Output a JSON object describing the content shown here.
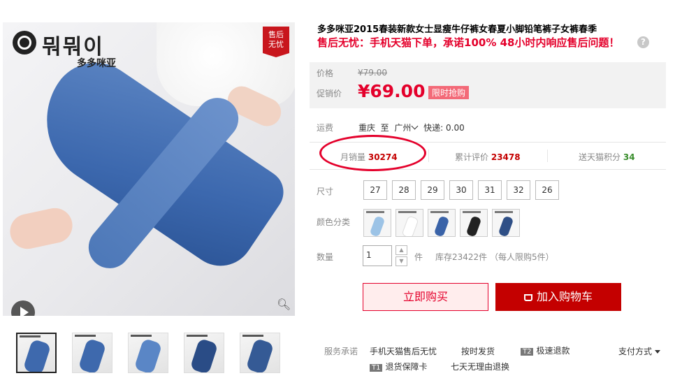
{
  "gallery": {
    "brand_korean": "뭐뭐이",
    "brand_chinese": "多多咪亚",
    "tag_line1": "售后",
    "tag_line2": "无忧",
    "thumbnails": [
      "thumb-1",
      "thumb-2",
      "thumb-3",
      "thumb-4",
      "thumb-5"
    ]
  },
  "product": {
    "title": "多多咪亚2015春装新款女士显瘦牛仔裤女春夏小脚铅笔裤子女裤春季",
    "subtitle": "售后无忧：手机天猫下单，承诺100% 48小时内响应售后问题！",
    "help_icon": "?"
  },
  "price": {
    "price_label": "价格",
    "original": "¥79.00",
    "promo_label": "促销价",
    "promo": "¥69.00",
    "badge": "限时抢购"
  },
  "shipping": {
    "label": "运费",
    "from": "重庆",
    "to_word": "至",
    "to": "广州",
    "method": "快递: 0.00"
  },
  "stats": {
    "monthly_label": "月销量",
    "monthly_value": "30274",
    "reviews_label": "累计评价",
    "reviews_value": "23478",
    "points_label": "送天猫积分",
    "points_value": "34"
  },
  "sizes": {
    "label": "尺寸",
    "options": [
      "27",
      "28",
      "29",
      "30",
      "31",
      "32",
      "26"
    ]
  },
  "colors": {
    "label": "颜色分类",
    "swatch_colors": [
      "#9cc3e6",
      "#ffffff",
      "#3a63a8",
      "#222222",
      "#2f4f86"
    ]
  },
  "quantity": {
    "label": "数量",
    "value": "1",
    "unit": "件",
    "stock": "库存23422件 （每人限购5件）"
  },
  "actions": {
    "buy_now": "立即购买",
    "add_to_cart": "加入购物车"
  },
  "services": {
    "label": "服务承诺",
    "items": [
      "手机天猫售后无忧",
      "按时发货",
      "极速退款",
      "退货保障卡",
      "七天无理由退换"
    ],
    "badge_t2": "T2",
    "badge_t1": "T1",
    "payment": "支付方式"
  }
}
